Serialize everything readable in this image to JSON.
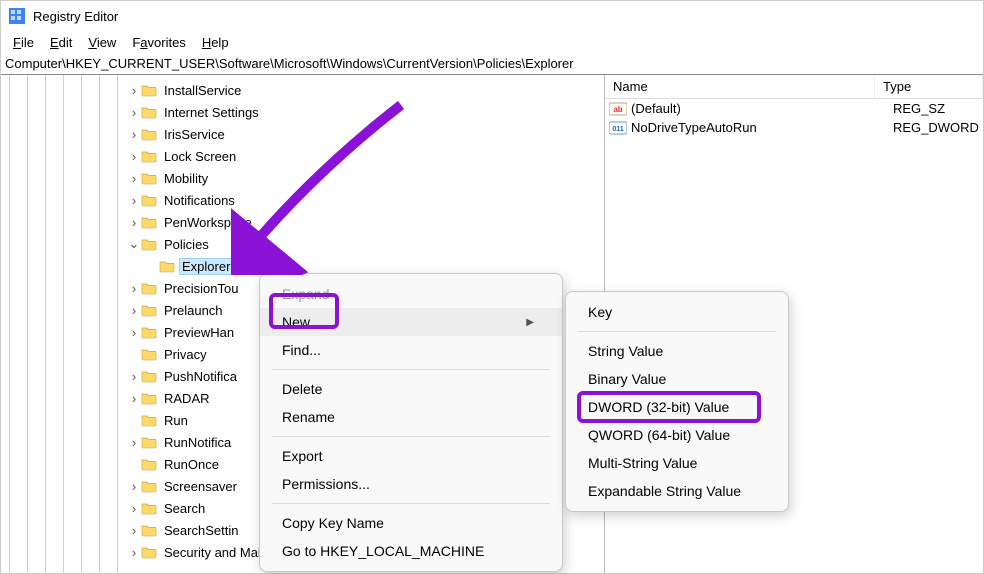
{
  "window": {
    "title": "Registry Editor"
  },
  "menubar": {
    "file": "File",
    "edit": "Edit",
    "view": "View",
    "favorites": "Favorites",
    "help": "Help"
  },
  "address": "Computer\\HKEY_CURRENT_USER\\Software\\Microsoft\\Windows\\CurrentVersion\\Policies\\Explorer",
  "tree": {
    "items": [
      {
        "label": "InstallService",
        "expander": "›",
        "depth": 7
      },
      {
        "label": "Internet Settings",
        "expander": "›",
        "depth": 7
      },
      {
        "label": "IrisService",
        "expander": "›",
        "depth": 7
      },
      {
        "label": "Lock Screen",
        "expander": "›",
        "depth": 7
      },
      {
        "label": "Mobility",
        "expander": "›",
        "depth": 7
      },
      {
        "label": "Notifications",
        "expander": "›",
        "depth": 7
      },
      {
        "label": "PenWorkspace",
        "expander": "›",
        "depth": 7
      },
      {
        "label": "Policies",
        "expander": "⌄",
        "depth": 7,
        "expanded": true
      },
      {
        "label": "Explorer",
        "expander": "",
        "depth": 8,
        "selected": true
      },
      {
        "label": "PrecisionTou",
        "expander": "›",
        "depth": 7
      },
      {
        "label": "Prelaunch",
        "expander": "›",
        "depth": 7
      },
      {
        "label": "PreviewHan",
        "expander": "›",
        "depth": 7
      },
      {
        "label": "Privacy",
        "expander": "",
        "depth": 7
      },
      {
        "label": "PushNotifica",
        "expander": "›",
        "depth": 7
      },
      {
        "label": "RADAR",
        "expander": "›",
        "depth": 7
      },
      {
        "label": "Run",
        "expander": "",
        "depth": 7
      },
      {
        "label": "RunNotifica",
        "expander": "›",
        "depth": 7
      },
      {
        "label": "RunOnce",
        "expander": "",
        "depth": 7
      },
      {
        "label": "Screensaver",
        "expander": "›",
        "depth": 7
      },
      {
        "label": "Search",
        "expander": "›",
        "depth": 7
      },
      {
        "label": "SearchSettin",
        "expander": "›",
        "depth": 7
      },
      {
        "label": "Security and Maintenance",
        "expander": "›",
        "depth": 7
      }
    ]
  },
  "list": {
    "headers": {
      "name": "Name",
      "type": "Type"
    },
    "rows": [
      {
        "name": "(Default)",
        "type": "REG_SZ",
        "iconKind": "str"
      },
      {
        "name": "NoDriveTypeAutoRun",
        "type": "REG_DWORD",
        "iconKind": "bin"
      }
    ]
  },
  "contextMenu": {
    "expand": "Expand",
    "new": "New",
    "find": "Find...",
    "delete": "Delete",
    "rename": "Rename",
    "export": "Export",
    "permissions": "Permissions...",
    "copyKey": "Copy Key Name",
    "goto": "Go to HKEY_LOCAL_MACHINE"
  },
  "newSubmenu": {
    "key": "Key",
    "string": "String Value",
    "binary": "Binary Value",
    "dword": "DWORD (32-bit) Value",
    "qword": "QWORD (64-bit) Value",
    "multi": "Multi-String Value",
    "expand": "Expandable String Value"
  }
}
